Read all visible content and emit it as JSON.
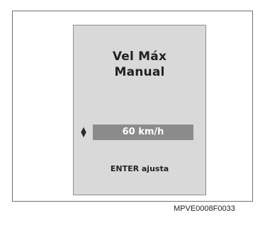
{
  "display": {
    "title_line1": "Vel Máx",
    "title_line2": "Manual",
    "value": "60 km/h",
    "hint": "ENTER ajusta",
    "up_arrow": "▲",
    "down_arrow": "▼"
  },
  "figure_code": "MPVE0008F0033"
}
